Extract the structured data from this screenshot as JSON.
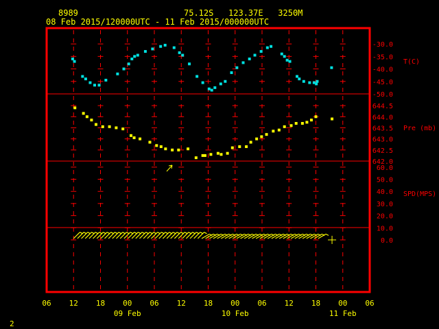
{
  "header": {
    "station_id": "8989",
    "location": "75.12S   123.37E   3250M",
    "time_range": "08 Feb 2015/120000UTC - 11 Feb 2015/000000UTC"
  },
  "corner_label": "2",
  "colors": {
    "frame": "#ff0000",
    "text": "#ffff00",
    "axis_text": "#ff0000",
    "temperature": "#00e0e0",
    "pressure": "#ffff00",
    "wind": "#ffff00",
    "background": "#000000"
  },
  "chart_data": {
    "type": "scatter",
    "x_axis": {
      "unit": "hours since 08 Feb 2015 06 UTC",
      "range": [
        0,
        72
      ],
      "tick_labels": [
        "06",
        "12",
        "18",
        "00",
        "06",
        "12",
        "18",
        "00",
        "06",
        "12",
        "18",
        "00",
        "06"
      ],
      "date_labels": [
        {
          "label": "09 Feb",
          "hour": 18
        },
        {
          "label": "10 Feb",
          "hour": 42
        },
        {
          "label": "11 Feb",
          "hour": 66
        }
      ]
    },
    "panels": [
      {
        "name": "temperature",
        "label": "T(C)",
        "range": [
          -50,
          -27.5
        ],
        "tick_labels": [
          "-30.0",
          "-35.0",
          "-40.0",
          "-45.0",
          "-50.0"
        ],
        "ticks": [
          -30,
          -35,
          -40,
          -45,
          -50
        ],
        "points": [
          [
            5.8,
            -36.0
          ],
          [
            6.2,
            -37.0
          ],
          [
            8.0,
            -43.0
          ],
          [
            8.7,
            -44.0
          ],
          [
            9.7,
            -45.5
          ],
          [
            10.7,
            -46.5
          ],
          [
            11.7,
            -46.5
          ],
          [
            13.2,
            -44.5
          ],
          [
            15.8,
            -42.0
          ],
          [
            17.2,
            -40.0
          ],
          [
            18.3,
            -38.0
          ],
          [
            19.0,
            -36.0
          ],
          [
            19.6,
            -35.0
          ],
          [
            20.3,
            -34.5
          ],
          [
            22.0,
            -33.0
          ],
          [
            23.6,
            -32.0
          ],
          [
            25.4,
            -31.0
          ],
          [
            26.4,
            -30.5
          ],
          [
            28.4,
            -31.5
          ],
          [
            29.6,
            -33.5
          ],
          [
            30.3,
            -34.5
          ],
          [
            31.8,
            -38.0
          ],
          [
            33.5,
            -43.0
          ],
          [
            34.8,
            -45.5
          ],
          [
            36.2,
            -48.0
          ],
          [
            36.8,
            -48.5
          ],
          [
            37.5,
            -47.5
          ],
          [
            38.8,
            -46.0
          ],
          [
            39.8,
            -45.0
          ],
          [
            41.2,
            -41.5
          ],
          [
            42.4,
            -39.5
          ],
          [
            43.8,
            -37.5
          ],
          [
            45.2,
            -36.0
          ],
          [
            46.4,
            -34.5
          ],
          [
            47.8,
            -33.0
          ],
          [
            49.2,
            -31.5
          ],
          [
            50.0,
            -31.0
          ],
          [
            52.4,
            -34.0
          ],
          [
            53.0,
            -35.0
          ],
          [
            53.6,
            -36.5
          ],
          [
            54.2,
            -37.0
          ],
          [
            55.8,
            -43.0
          ],
          [
            56.3,
            -44.0
          ],
          [
            57.3,
            -45.0
          ],
          [
            58.6,
            -45.5
          ],
          [
            59.6,
            -45.5
          ],
          [
            60.1,
            -46.0
          ],
          [
            60.3,
            -45.0
          ],
          [
            63.5,
            -39.5
          ]
        ]
      },
      {
        "name": "pressure",
        "label": "Pre (mb)",
        "range": [
          642.0,
          644.75
        ],
        "tick_labels": [
          "644.5",
          "644.0",
          "643.5",
          "643.0",
          "642.5",
          "642.0"
        ],
        "ticks": [
          644.5,
          644.0,
          643.5,
          643.0,
          642.5,
          642.0
        ],
        "points": [
          [
            6.3,
            644.4
          ],
          [
            8.2,
            644.15
          ],
          [
            9.0,
            644.0
          ],
          [
            10.0,
            643.85
          ],
          [
            11.0,
            643.65
          ],
          [
            12.5,
            643.55
          ],
          [
            14.0,
            643.55
          ],
          [
            15.5,
            643.5
          ],
          [
            17.0,
            643.45
          ],
          [
            18.8,
            643.15
          ],
          [
            19.5,
            643.05
          ],
          [
            20.8,
            643.0
          ],
          [
            23.0,
            642.85
          ],
          [
            24.5,
            642.7
          ],
          [
            25.5,
            642.65
          ],
          [
            26.5,
            642.55
          ],
          [
            28.0,
            642.5
          ],
          [
            29.4,
            642.5
          ],
          [
            31.5,
            642.55
          ],
          [
            33.3,
            642.15
          ],
          [
            34.8,
            642.25
          ],
          [
            35.3,
            642.25
          ],
          [
            36.6,
            642.3
          ],
          [
            38.2,
            642.35
          ],
          [
            38.9,
            642.3
          ],
          [
            40.3,
            642.35
          ],
          [
            41.4,
            642.6
          ],
          [
            43.0,
            642.65
          ],
          [
            44.5,
            642.65
          ],
          [
            45.5,
            642.85
          ],
          [
            46.8,
            643.0
          ],
          [
            47.9,
            643.1
          ],
          [
            49.0,
            643.2
          ],
          [
            50.5,
            643.35
          ],
          [
            51.8,
            643.4
          ],
          [
            53.0,
            643.55
          ],
          [
            54.5,
            643.6
          ],
          [
            55.6,
            643.7
          ],
          [
            57.0,
            643.7
          ],
          [
            58.0,
            643.75
          ],
          [
            59.0,
            643.85
          ],
          [
            60.0,
            644.0
          ],
          [
            63.6,
            643.9
          ]
        ]
      },
      {
        "name": "wind_speed",
        "label": "SPD(MPS)",
        "range": [
          0,
          65
        ],
        "tick_labels": [
          "60.0",
          "50.0",
          "40.0",
          "30.0",
          "20.0",
          "10.0",
          "0.0"
        ],
        "ticks": [
          60,
          50,
          40,
          30,
          20,
          10,
          0
        ],
        "wind_barbs_from_deg": [
          225,
          225,
          225,
          225,
          225,
          225,
          225,
          225,
          225,
          225,
          225,
          225,
          225,
          225,
          225,
          225,
          225,
          225,
          225,
          225,
          225,
          225,
          225,
          225,
          225,
          225,
          225,
          225,
          225,
          225,
          225,
          225,
          225,
          240,
          240,
          240,
          240,
          240,
          240,
          240,
          240,
          240,
          240,
          240,
          240,
          240,
          240,
          240,
          240,
          240,
          240,
          240,
          240,
          240,
          240,
          240,
          240,
          240,
          240,
          240,
          240,
          240,
          240,
          240
        ]
      }
    ]
  }
}
